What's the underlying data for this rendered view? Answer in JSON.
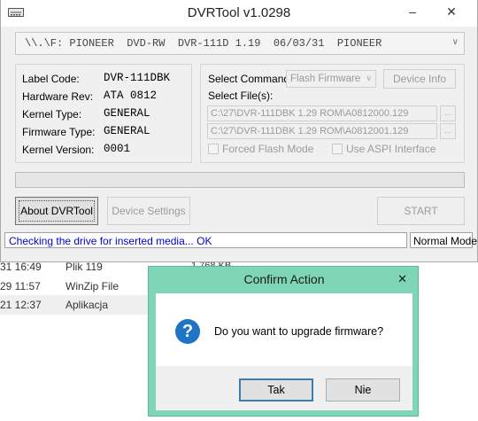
{
  "app": {
    "title": "DVRTool v1.0298",
    "drive": "\\\\.\\F: PIONEER  DVD-RW  DVR-111D 1.19  06/03/31  PIONEER"
  },
  "info": {
    "rows": [
      {
        "label": "Label Code:",
        "value": "DVR-111DBK"
      },
      {
        "label": "Hardware Rev:",
        "value": "ATA 0812"
      },
      {
        "label": "Kernel Type:",
        "value": "GENERAL"
      },
      {
        "label": "Firmware Type:",
        "value": "GENERAL"
      },
      {
        "label": "Kernel Version:",
        "value": "0001"
      }
    ]
  },
  "command": {
    "select_label": "Select Command:",
    "selected": "Flash Firmware",
    "device_info_button": "Device Info",
    "files_label": "Select File(s):",
    "file1": "C:\\27\\DVR-111DBK 1.29 ROM\\A0812000.129",
    "file2": "C:\\27\\DVR-111DBK 1.29 ROM\\A0812001.129",
    "browse": "...",
    "forced_flash": "Forced Flash Mode",
    "use_aspi": "Use ASPI Interface"
  },
  "progress": {
    "value": 0
  },
  "buttons": {
    "about": "About DVRTool",
    "device_settings": "Device Settings",
    "start": "START"
  },
  "status": {
    "message": "Checking the drive for inserted media... OK",
    "mode": "Normal Mode"
  },
  "background_list": [
    {
      "time": "31 16:49",
      "name": "Plik 119"
    },
    {
      "time": "29 11:57",
      "name": "WinZip File"
    },
    {
      "time": "21 12:37",
      "name": "Aplikacja"
    }
  ],
  "background_size": "1 768 KB",
  "dialog": {
    "title": "Confirm Action",
    "close": "✕",
    "message": "Do you want to upgrade firmware?",
    "icon": "question-icon",
    "yes": "Tak",
    "no": "Nie"
  },
  "colors": {
    "dialog_frame": "#7ed6b6",
    "status_text": "#0000cc",
    "question_icon": "#1f74c6"
  }
}
